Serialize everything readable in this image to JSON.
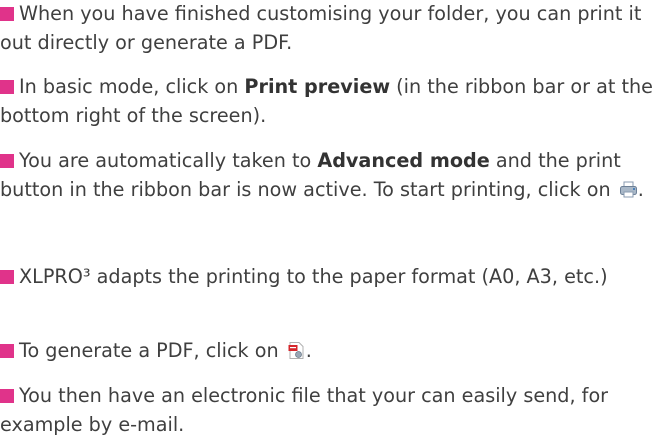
{
  "colors": {
    "bullet": "#e0338a",
    "text": "#3f3f3f"
  },
  "items": [
    {
      "text": "When you have finished customising your folder, you can print it out directly or generate a PDF."
    },
    {
      "before": "In basic mode, click on ",
      "bold": "Print preview",
      "after": " (in the ribbon bar or at the bottom right of the screen)."
    },
    {
      "before": "You are automatically taken to ",
      "bold": "Advanced mode",
      "middle": " and the print button in the ribbon bar is now active. To start printing, click on ",
      "icon": "printer-icon",
      "after": "."
    },
    {
      "text": "XLPRO³ adapts the printing to the paper format (A0, A3, etc.)"
    },
    {
      "before": "To generate a PDF, click on ",
      "icon": "pdf-icon",
      "after": "."
    },
    {
      "text": "You then have an electronic file that your can easily send, for example by e-mail."
    }
  ]
}
